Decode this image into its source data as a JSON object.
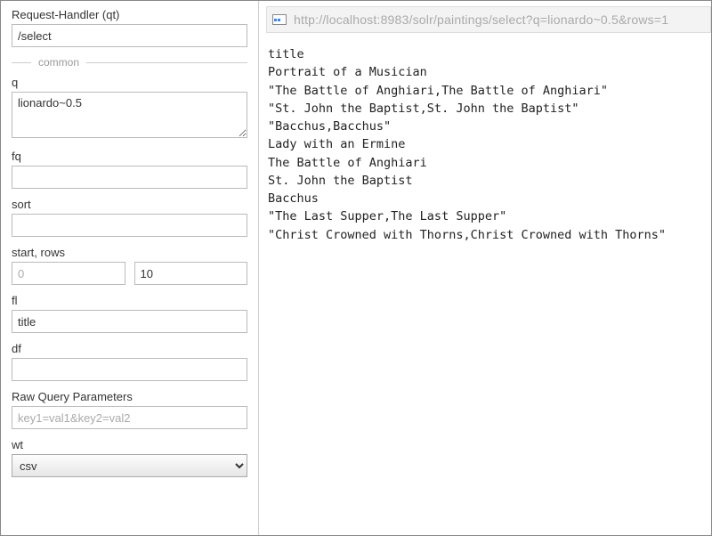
{
  "form": {
    "request_handler": {
      "label": "Request-Handler (qt)",
      "value": "/select"
    },
    "common_label": "common",
    "q": {
      "label": "q",
      "value": "lionardo~0.5"
    },
    "fq": {
      "label": "fq",
      "value": ""
    },
    "sort": {
      "label": "sort",
      "value": ""
    },
    "start_rows": {
      "label": "start, rows",
      "start_placeholder": "0",
      "rows_value": "10"
    },
    "fl": {
      "label": "fl",
      "value": "title"
    },
    "df": {
      "label": "df",
      "value": ""
    },
    "raw": {
      "label": "Raw Query Parameters",
      "placeholder": "key1=val1&key2=val2"
    },
    "wt": {
      "label": "wt",
      "value": "csv"
    }
  },
  "url": "http://localhost:8983/solr/paintings/select?q=lionardo~0.5&rows=1",
  "results_header": "title",
  "results": [
    "Portrait of a Musician",
    "\"The Battle of Anghiari,The Battle of Anghiari\"",
    "\"St. John the Baptist,St. John the Baptist\"",
    "\"Bacchus,Bacchus\"",
    "Lady with an Ermine",
    "The Battle of Anghiari",
    "St. John the Baptist",
    "Bacchus",
    "\"The Last Supper,The Last Supper\"",
    "\"Christ Crowned with Thorns,Christ Crowned with Thorns\""
  ]
}
